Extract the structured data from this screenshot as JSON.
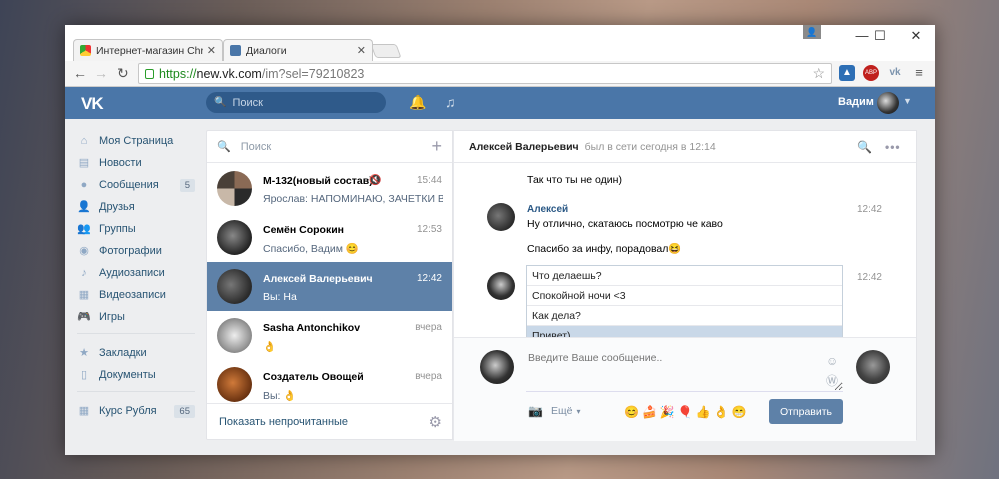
{
  "browser": {
    "tabs": [
      {
        "label": "Интернет-магазин Chrom"
      },
      {
        "label": "Диалоги"
      }
    ],
    "controls": {
      "minimize": "—",
      "maximize": "☐",
      "close": "✕"
    },
    "url": {
      "scheme": "https://",
      "host": "new.vk.com",
      "path": "/im?sel=79210823"
    },
    "ext_abp": "ABP"
  },
  "vk": {
    "logo": "VK",
    "search_placeholder": "Поиск",
    "user_name": "Вадим"
  },
  "sidebar": {
    "items": [
      {
        "label": "Моя Страница",
        "icon": "home-icon"
      },
      {
        "label": "Новости",
        "icon": "news-icon"
      },
      {
        "label": "Сообщения",
        "icon": "messages-icon",
        "count": "5"
      },
      {
        "label": "Друзья",
        "icon": "friends-icon"
      },
      {
        "label": "Группы",
        "icon": "groups-icon"
      },
      {
        "label": "Фотографии",
        "icon": "camera-icon"
      },
      {
        "label": "Аудиозаписи",
        "icon": "music-icon"
      },
      {
        "label": "Видеозаписи",
        "icon": "video-icon"
      },
      {
        "label": "Игры",
        "icon": "gamepad-icon"
      },
      {
        "label": "Закладки",
        "icon": "star-icon"
      },
      {
        "label": "Документы",
        "icon": "document-icon"
      },
      {
        "label": "Курс Рубля",
        "icon": "grid-icon",
        "count": "65"
      }
    ]
  },
  "dialogs": {
    "search_placeholder": "Поиск",
    "items": [
      {
        "name": "М-132(новый состав)",
        "time": "15:44",
        "text": "Ярослав: НАПОМИНАЮ, ЗАЧЕТКИ В Д..."
      },
      {
        "name": "Семён Сорокин",
        "time": "12:53",
        "text": "Спасибо, Вадим 😊"
      },
      {
        "name": "Алексей Валерьевич",
        "time": "12:42",
        "text": "Вы: На"
      },
      {
        "name": "Sasha Antonchikov",
        "time": "вчера",
        "text": "👌"
      },
      {
        "name": "Создатель Овощей",
        "time": "вчера",
        "text": "Вы: 👌"
      }
    ],
    "show_unread": "Показать непрочитанные"
  },
  "chat": {
    "contact": "Алексей Валерьевич",
    "status": "был в сети сегодня в 12:14",
    "messages": {
      "m1": "Так что ты не один)",
      "sender": "Алексей",
      "time1": "12:42",
      "m2": "Ну отлично, скатаюсь посмотрю че каво",
      "m3": "Спасибо за инфу, порадовал😆",
      "time2": "12:42"
    },
    "suggestions": [
      "Что делаешь?",
      "Спокойной ночи <3",
      "Как дела?",
      "Привет)"
    ],
    "input_placeholder": "Введите Ваше сообщение..",
    "more_label": "Ещё",
    "emojis": "😊🍰🎉🎈👍👌😁",
    "send_label": "Отправить"
  }
}
